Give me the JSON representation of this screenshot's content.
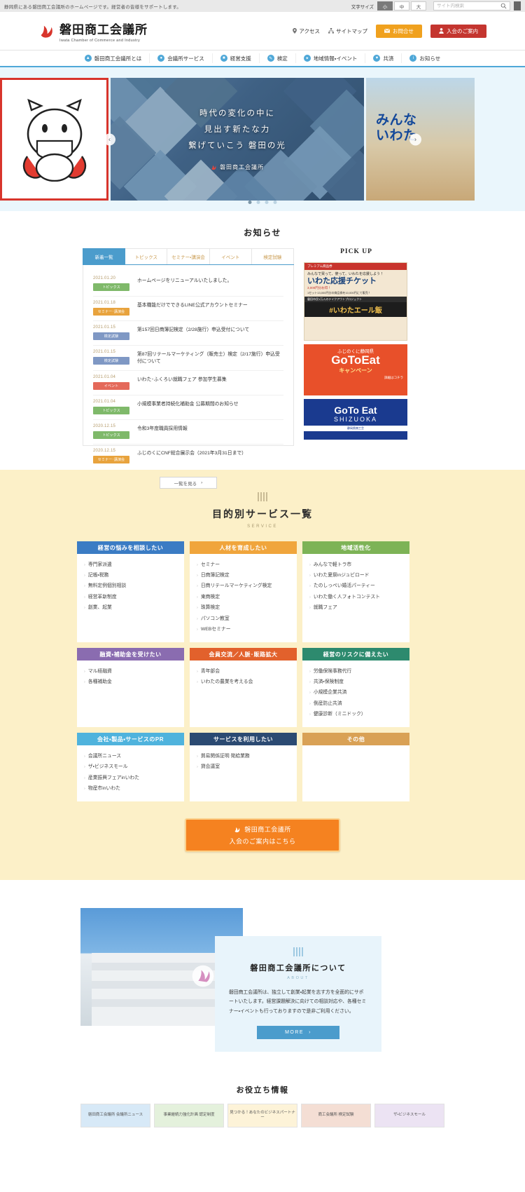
{
  "utility": {
    "tagline": "静岡県にある磐田商工会議所のホームページです。経営者の皆様をサポートします。",
    "font_size_label": "文字サイズ",
    "font_sizes": [
      {
        "label": "小",
        "active": true
      },
      {
        "label": "中",
        "active": false
      },
      {
        "label": "大",
        "active": false
      }
    ],
    "search_placeholder": "サイト内検索"
  },
  "header": {
    "logo_ja": "磐田商工会議所",
    "logo_en": "Iwata Chamber of Commerce and Industry",
    "links": [
      {
        "label": "アクセス",
        "icon": "pin-icon"
      },
      {
        "label": "サイトマップ",
        "icon": "sitemap-icon"
      }
    ],
    "buttons": [
      {
        "label": "お問合せ",
        "icon": "mail-icon",
        "color": "#f0a11e"
      },
      {
        "label": "入会のご案内",
        "icon": "person-icon",
        "color": "#c4352f"
      }
    ]
  },
  "gnav": {
    "items": [
      {
        "label": "磐田商工会議所とは",
        "icon": "building-icon"
      },
      {
        "label": "会議所サービス",
        "icon": "service-icon"
      },
      {
        "label": "経営支援",
        "icon": "support-icon"
      },
      {
        "label": "検定",
        "icon": "pencil-icon"
      },
      {
        "label": "地域情報・イベント",
        "icon": "star-icon"
      },
      {
        "label": "共済",
        "icon": "heart-icon"
      },
      {
        "label": "お知らせ",
        "icon": "info-icon"
      }
    ]
  },
  "hero": {
    "main_copy_line1": "時代の変化の中に",
    "main_copy_line2": "見出す新たな力",
    "main_copy_line3": "繋げていこう 磐田の光",
    "main_brand": "磐田商工会議所",
    "side_right_line1": "みんな",
    "side_right_line2": "いわた",
    "prev_label": "‹",
    "next_label": "›",
    "dots": 4,
    "active_dot": 0
  },
  "news": {
    "title": "お知らせ",
    "tabs": [
      {
        "label": "新着一覧",
        "active": true
      },
      {
        "label": "トピックス",
        "active": false
      },
      {
        "label": "セミナー・講演会",
        "active": false
      },
      {
        "label": "イベント",
        "active": false
      },
      {
        "label": "検定試験",
        "active": false
      }
    ],
    "items": [
      {
        "date": "2021.01.20",
        "cat": "トピックス",
        "cat_color": "#7fb96a",
        "title": "ホームページをリニューアルいたしました。"
      },
      {
        "date": "2021.01.18",
        "cat": "セミナー･講演会",
        "cat_color": "#e8a33d",
        "title": "基本機能だけでできるLINE公式アカウントセミナー"
      },
      {
        "date": "2021.01.15",
        "cat": "検定試験",
        "cat_color": "#7f98c4",
        "title": "第157回日商簿記検定（2/28施行）申込受付について"
      },
      {
        "date": "2021.01.15",
        "cat": "検定試験",
        "cat_color": "#7f98c4",
        "title": "第87回リテールマーケティング（販売士）検定（2/17施行）申込受付について"
      },
      {
        "date": "2021.01.04",
        "cat": "イベント",
        "cat_color": "#e4695a",
        "title": "いわた･ふくろい就職フェア 参加学生募集"
      },
      {
        "date": "2021.01.04",
        "cat": "トピックス",
        "cat_color": "#7fb96a",
        "title": "小規模事業者持続化補助金 公募期間のお知らせ"
      },
      {
        "date": "2020.12.15",
        "cat": "トピックス",
        "cat_color": "#7fb96a",
        "title": "令和3年度職員採用情報"
      },
      {
        "date": "2020.12.15",
        "cat": "セミナー･講演会",
        "cat_color": "#e8a33d",
        "title": "ふじのくにCNF総合展示会（2021年3月31日まで）"
      }
    ],
    "more_label": "一覧を見る"
  },
  "pickup": {
    "title": "PICK UP",
    "banners": [
      {
        "name": "iwata-ouen-ticket-banner",
        "headline": "プレミアム商品券",
        "lead": "みんなで買って、使って、いわたを応援しよう！",
        "main": "いわた応援チケット",
        "amount": "3,000円分お得！",
        "detail": "1セット13,000円分の商品券を10,000円にて販売！",
        "sub": "磐田市民1万人のテイクアウトプロジェクト",
        "tag": "#いわたエール飯"
      },
      {
        "name": "goto-eat-banner",
        "line1": "ふじのくに静岡県",
        "main": "GoToEat",
        "sub": "キャンペーン",
        "link": "詳細はコチラ"
      },
      {
        "name": "goto-eat-shizuoka-banner",
        "main": "GoTo Eat",
        "sub": "SHIZUOKA",
        "note": "静岡県商工会"
      }
    ]
  },
  "service": {
    "title": "目的別サービス一覧",
    "subtitle": "SERVICE",
    "cards": [
      {
        "heading": "経営の悩みを相談したい",
        "color": "#3b7cc4",
        "items": [
          "専門家派遣",
          "記帳・税務",
          "無料定例個別相談",
          "経営革新制度",
          "創業、起業"
        ]
      },
      {
        "heading": "人材を育成したい",
        "color": "#f0a53c",
        "items": [
          "セミナー",
          "日商簿記検定",
          "日商リテールマーケティング検定",
          "東商検定",
          "珠算検定",
          "パソコン教室",
          "WEBセミナー"
        ]
      },
      {
        "heading": "地域活性化",
        "color": "#7db356",
        "items": [
          "みんなで軽トラ市",
          "いわた夏祭inジュビロード",
          "たのしっぺい婚活パーティー",
          "いわた働く人フォトコンテスト",
          "就職フェア"
        ]
      },
      {
        "heading": "融資・補助金を受けたい",
        "color": "#8a6cb0",
        "items": [
          "マル経融資",
          "各種補助金"
        ]
      },
      {
        "heading": "会員交流／人脈･販路拡大",
        "color": "#e2612c",
        "items": [
          "青年部会",
          "いわたの農業を考える会"
        ]
      },
      {
        "heading": "経営のリスクに備えたい",
        "color": "#2d8a6e",
        "items": [
          "労働保険事務代行",
          "共済・保険制度",
          "小規模企業共済",
          "倒産防止共済",
          "健康診断（ミニドック）"
        ]
      },
      {
        "heading": "会社・製品・サービスのPR",
        "color": "#4fb3dd",
        "items": [
          "会議所ニュース",
          "ザ・ビジネスモール",
          "産業振興フェアinいわた",
          "物産市inいわた"
        ]
      },
      {
        "heading": "サービスを利用したい",
        "color": "#2b4a72",
        "items": [
          "貿易関係証明 発給業務",
          "貸会議室"
        ]
      },
      {
        "heading": "その他",
        "color": "#d9a155",
        "items": []
      }
    ],
    "cta_line1": "磐田商工会議所",
    "cta_line2": "入会のご案内はこちら"
  },
  "about": {
    "title": "磐田商工会議所について",
    "subtitle": "ABOUT",
    "body": "磐田商工会議所は、独立して創業・起業を志す方を全面的にサポートいたします。経営課題解決に向けての相談対応や、各種セミナー・イベントも行っておりますので是非ご利用ください。",
    "more_label": "MORE"
  },
  "useful": {
    "title": "お役立ち情報",
    "cards": [
      {
        "label": "磐田商工会議所 会議所ニュース"
      },
      {
        "label": "事業継続力強化計画 認定制度"
      },
      {
        "label": "見つかる！あなたのビジネスパートナー"
      },
      {
        "label": "商工会議所 検定試験"
      },
      {
        "label": "ザ・ビジネスモール"
      }
    ]
  }
}
